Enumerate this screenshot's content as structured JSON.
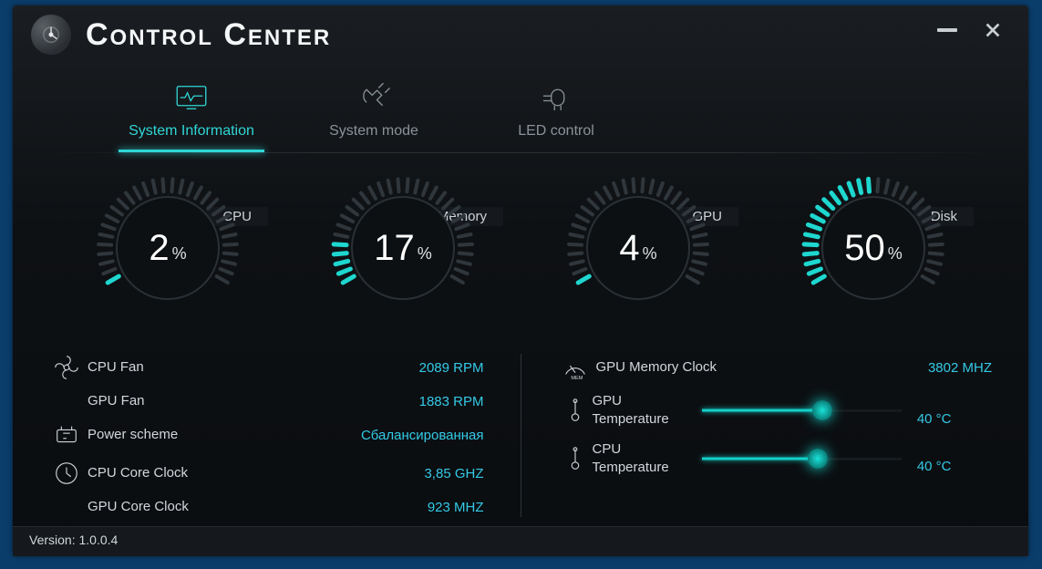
{
  "app": {
    "title": "Control Center",
    "version_label": "Version: 1.0.0.4"
  },
  "tabs": [
    {
      "label": "System Information",
      "active": true
    },
    {
      "label": "System mode",
      "active": false
    },
    {
      "label": "LED control",
      "active": false
    }
  ],
  "gauges": {
    "cpu": {
      "label": "CPU",
      "value": 2,
      "unit": "%"
    },
    "memory": {
      "label": "Memory",
      "value": 17,
      "unit": "%"
    },
    "gpu": {
      "label": "GPU",
      "value": 4,
      "unit": "%"
    },
    "disk": {
      "label": "Disk",
      "value": 50,
      "unit": "%"
    }
  },
  "stats_left": {
    "cpu_fan": {
      "label": "CPU Fan",
      "value": "2089 RPM"
    },
    "gpu_fan": {
      "label": "GPU Fan",
      "value": "1883 RPM"
    },
    "power_scheme": {
      "label": "Power scheme",
      "value": "Сбалансированная"
    },
    "cpu_core_clock": {
      "label": "CPU Core Clock",
      "value": "3,85 GHZ"
    },
    "gpu_core_clock": {
      "label": "GPU Core Clock",
      "value": "923 MHZ"
    }
  },
  "stats_right": {
    "gpu_mem_clock": {
      "label": "GPU Memory Clock",
      "value": "3802 MHZ"
    },
    "gpu_temp": {
      "label": "GPU\nTemperature",
      "value": "40 °C",
      "slider_pct": 60
    },
    "cpu_temp": {
      "label": "CPU\nTemperature",
      "value": "40 °C",
      "slider_pct": 58
    }
  }
}
